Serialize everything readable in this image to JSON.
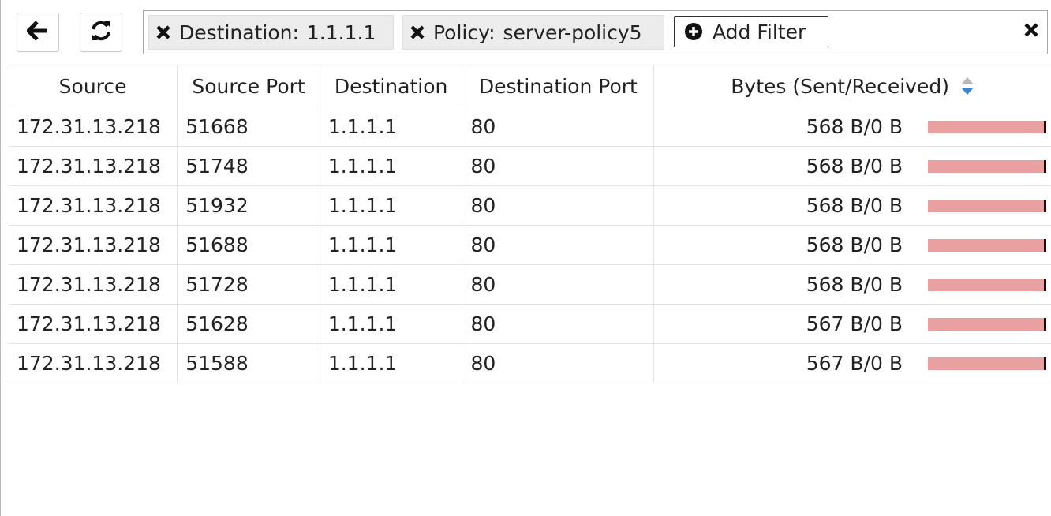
{
  "toolbar": {
    "back_icon": "arrow-left-icon",
    "refresh_icon": "refresh-icon"
  },
  "filters": [
    {
      "key": "Destination:",
      "value": "1.1.1.1"
    },
    {
      "key": "Policy:",
      "value": "server-policy5"
    }
  ],
  "add_filter_label": "Add Filter",
  "table": {
    "headers": [
      "Source",
      "Source Port",
      "Destination",
      "Destination Port",
      "Bytes (Sent/Received)"
    ],
    "rows": [
      {
        "source": "172.31.13.218",
        "source_port": "51668",
        "destination": "1.1.1.1",
        "destination_port": "80",
        "bytes": "568 B/0 B",
        "sent_fraction": 1.0
      },
      {
        "source": "172.31.13.218",
        "source_port": "51748",
        "destination": "1.1.1.1",
        "destination_port": "80",
        "bytes": "568 B/0 B",
        "sent_fraction": 1.0
      },
      {
        "source": "172.31.13.218",
        "source_port": "51932",
        "destination": "1.1.1.1",
        "destination_port": "80",
        "bytes": "568 B/0 B",
        "sent_fraction": 1.0
      },
      {
        "source": "172.31.13.218",
        "source_port": "51688",
        "destination": "1.1.1.1",
        "destination_port": "80",
        "bytes": "568 B/0 B",
        "sent_fraction": 1.0
      },
      {
        "source": "172.31.13.218",
        "source_port": "51728",
        "destination": "1.1.1.1",
        "destination_port": "80",
        "bytes": "568 B/0 B",
        "sent_fraction": 1.0
      },
      {
        "source": "172.31.13.218",
        "source_port": "51628",
        "destination": "1.1.1.1",
        "destination_port": "80",
        "bytes": "567 B/0 B",
        "sent_fraction": 1.0
      },
      {
        "source": "172.31.13.218",
        "source_port": "51588",
        "destination": "1.1.1.1",
        "destination_port": "80",
        "bytes": "567 B/0 B",
        "sent_fraction": 1.0
      }
    ]
  },
  "colors": {
    "sent_bar": "#e8a0a0",
    "sort_active": "#3b86d4"
  }
}
